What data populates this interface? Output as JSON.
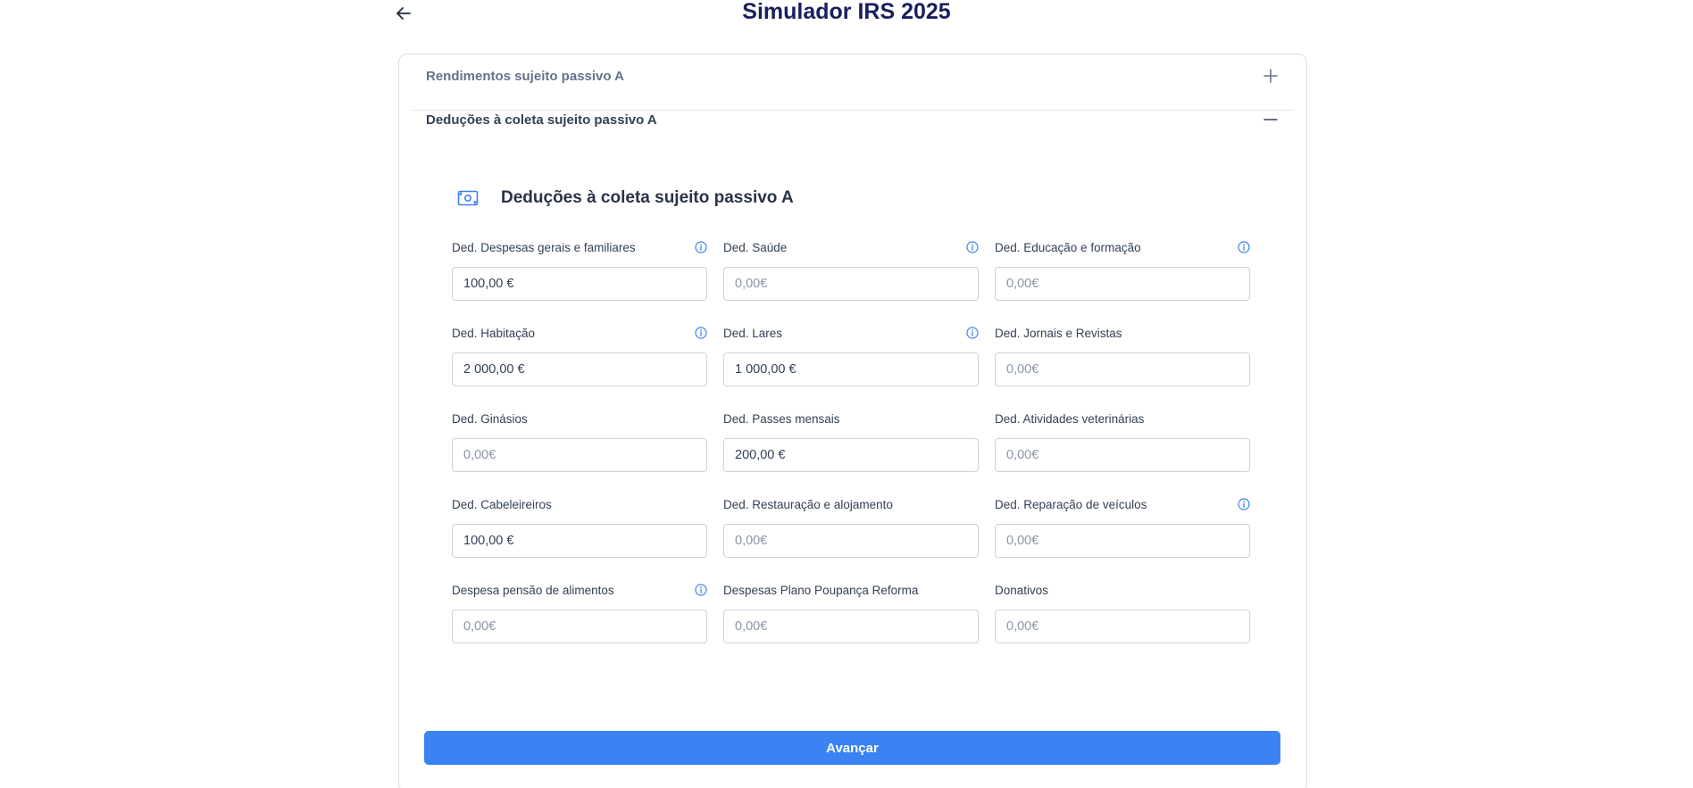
{
  "header": {
    "title": "Simulador IRS 2025",
    "back_icon": "arrow-left-icon"
  },
  "accordion": {
    "sections": [
      {
        "title": "Rendimentos sujeito passivo A",
        "state": "collapsed",
        "icon": "plus-icon"
      },
      {
        "title": "Deduções à coleta sujeito passivo A",
        "state": "expanded",
        "icon": "minus-icon"
      }
    ]
  },
  "deductions": {
    "heading": "Deduções à coleta sujeito passivo A",
    "heading_icon": "money-icon",
    "fields": [
      {
        "label": "Ded. Despesas gerais e familiares",
        "value": "100,00 €",
        "placeholder": "0,00€",
        "info": true
      },
      {
        "label": "Ded. Saúde",
        "value": "",
        "placeholder": "0,00€",
        "info": true
      },
      {
        "label": "Ded. Educação e formação",
        "value": "",
        "placeholder": "0,00€",
        "info": true
      },
      {
        "label": "Ded. Habitação",
        "value": "2 000,00 €",
        "placeholder": "0,00€",
        "info": true
      },
      {
        "label": "Ded. Lares",
        "value": "1 000,00 €",
        "placeholder": "0,00€",
        "info": true
      },
      {
        "label": "Ded. Jornais e Revistas",
        "value": "",
        "placeholder": "0,00€",
        "info": false
      },
      {
        "label": "Ded. Ginásios",
        "value": "",
        "placeholder": "0,00€",
        "info": false
      },
      {
        "label": "Ded. Passes mensais",
        "value": "200,00 €",
        "placeholder": "0,00€",
        "info": false
      },
      {
        "label": "Ded. Atividades veterinárias",
        "value": "",
        "placeholder": "0,00€",
        "info": false
      },
      {
        "label": "Ded. Cabeleireiros",
        "value": "100,00 €",
        "placeholder": "0,00€",
        "info": false
      },
      {
        "label": "Ded. Restauração e alojamento",
        "value": "",
        "placeholder": "0,00€",
        "info": false
      },
      {
        "label": "Ded. Reparação de veículos",
        "value": "",
        "placeholder": "0,00€",
        "info": true
      },
      {
        "label": "Despesa pensão de alimentos",
        "value": "",
        "placeholder": "0,00€",
        "info": true
      },
      {
        "label": "Despesas Plano Poupança Reforma",
        "value": "",
        "placeholder": "0,00€",
        "info": false
      },
      {
        "label": "Donativos",
        "value": "",
        "placeholder": "0,00€",
        "info": false
      }
    ]
  },
  "actions": {
    "next_label": "Avançar"
  },
  "colors": {
    "primary": "#3b82f2",
    "title": "#1a1f5e",
    "border": "#cbd2db"
  }
}
